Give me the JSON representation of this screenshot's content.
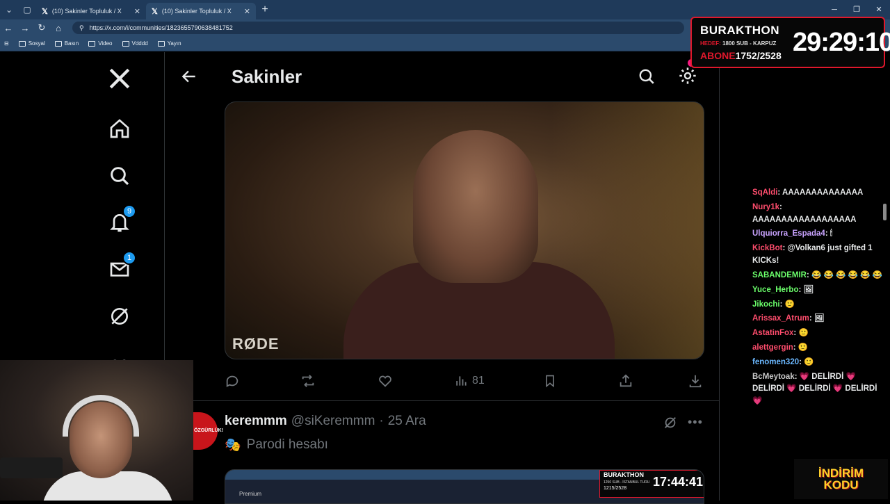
{
  "browser": {
    "tabs": [
      {
        "title": "(10) Sakinler Topluluk / X"
      },
      {
        "title": "(10) Sakinler Topluluk / X"
      }
    ],
    "url": "https://x.com/i/communities/1823655790638481752",
    "bookmarks": [
      "Sosyal",
      "Basın",
      "Video",
      "Vdddd",
      "Yayın"
    ]
  },
  "nav": {
    "notifications_count": "9",
    "messages_count": "1"
  },
  "header": {
    "title": "Sakinler",
    "settings_badge": "18"
  },
  "tweet1": {
    "views": "81",
    "media_brand": "RØDE"
  },
  "tweet2": {
    "name": "keremmm",
    "handle": "@siKeremmm",
    "separator": "·",
    "date": "25 Ara",
    "text": "Parodi hesabı",
    "avatar_text": "ÖZGÜRLÜK!",
    "preview": {
      "overlay_name": "BURAKTHON",
      "overlay_goal": "1250 SUB - İSTANBUL TURU",
      "overlay_sub": "1215/2528",
      "overlay_timer": "17:44:41",
      "premium": "Premium"
    }
  },
  "chat": [
    {
      "user": "SqAldi",
      "color": "#ff4d6d",
      "msg": "AAAAAAAAAAAAAA"
    },
    {
      "user": "Nury1k",
      "color": "#ff4d6d",
      "msg": "AAAAAAAAAAAAAAAAAA"
    },
    {
      "user": "Ulquiorra_Espada4",
      "color": "#c9a3ff",
      "msg": "🕯"
    },
    {
      "user": "KickBot",
      "color": "#ff4d6d",
      "msg": "@Volkan6 just gifted 1 KICKs!"
    },
    {
      "user": "SABANDEMIR",
      "color": "#6bff6b",
      "msg": "😂 😂 😂 😂 😂 😂"
    },
    {
      "user": "Yuce_Herbo",
      "color": "#6bff6b",
      "msg": "🖼"
    },
    {
      "user": "Jikochi",
      "color": "#6bff6b",
      "msg": "🙂"
    },
    {
      "user": "Arissax_Atrum",
      "color": "#ff4d6d",
      "msg": "🖼"
    },
    {
      "user": "AstatinFox",
      "color": "#ff4d6d",
      "msg": "🙂"
    },
    {
      "user": "alettgergin",
      "color": "#ff4d6d",
      "msg": "🙂"
    },
    {
      "user": "fenomen320",
      "color": "#6bb8ff",
      "msg": "🙂"
    },
    {
      "user": "BcMeytoak",
      "color": "#c9c9c9",
      "msg": "💗 DELİRDİ 💗 DELİRDİ 💗 DELİRDİ 💗 DELİRDİ 💗"
    }
  ],
  "stream_overlay": {
    "name": "BURAKTHON",
    "goal_label": "HEDEF:",
    "goal": "1800 SUB - KARPUZ",
    "sub_label": "ABONE",
    "sub_count": "1752/2528",
    "timer": "29:29:10"
  },
  "promo": {
    "line1": "İNDİRİM",
    "line2": "KODU"
  },
  "colors": {
    "accent": "#1d9bf0",
    "overlay_red": "#e0182c",
    "notification_pink": "#f91880"
  }
}
